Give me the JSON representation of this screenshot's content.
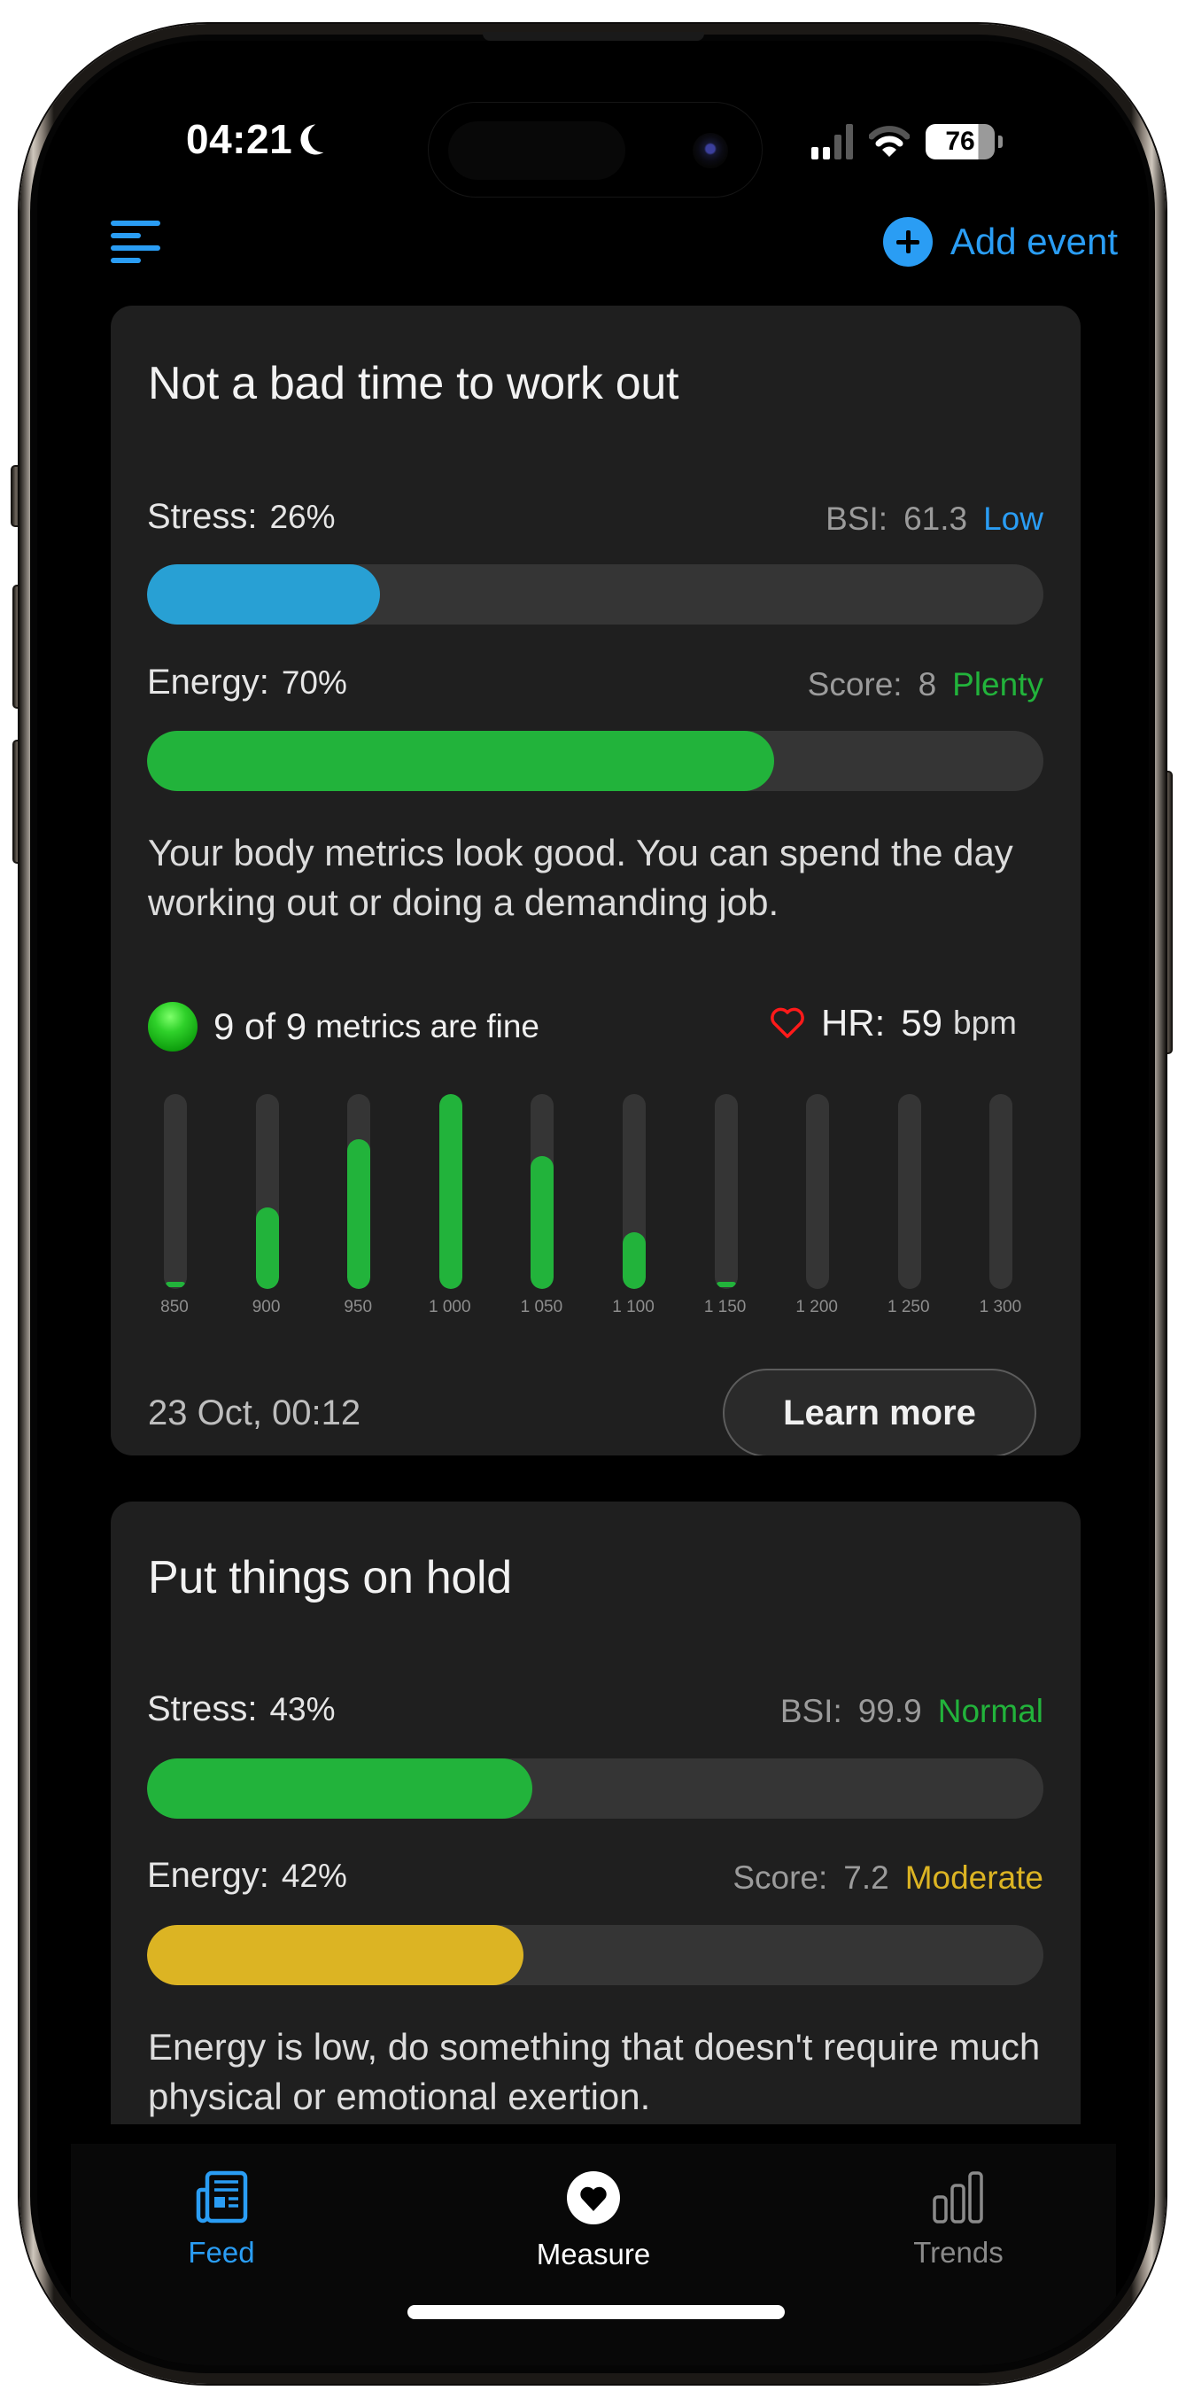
{
  "status_bar": {
    "time": "04:21",
    "focus_icon": "moon-icon",
    "signal_bars_active": 2,
    "signal_bars_total": 4,
    "wifi_icon": "wifi-icon",
    "battery_percent": "76"
  },
  "header": {
    "menu_icon": "menu-icon",
    "add_event_label": "Add event",
    "add_event_icon": "plus-circle-icon"
  },
  "colors": {
    "accent": "#2a9df4",
    "green": "#22b33b",
    "blue_fill": "#28a0d4",
    "yellow": "#dcb423",
    "track": "#353535",
    "card_bg": "#1f1f1f",
    "status_low": "#2a9df4",
    "status_plenty": "#22b33b",
    "status_normal": "#22b33b",
    "status_moderate": "#dcb423",
    "heart": "#ff1a1a"
  },
  "cards": [
    {
      "title": "Not a bad time to work out",
      "stress": {
        "label": "Stress:",
        "value": "26%",
        "fraction": 0.26,
        "metric_label": "BSI:",
        "metric_value": "61.3",
        "status": "Low",
        "fill_color": "#28a0d4",
        "status_color": "#2a9df4"
      },
      "energy": {
        "label": "Energy:",
        "value": "70%",
        "fraction": 0.7,
        "metric_label": "Score:",
        "metric_value": "8",
        "status": "Plenty",
        "fill_color": "#22b33b",
        "status_color": "#22b33b"
      },
      "description": "Your body metrics look good. You can spend the day working out or doing a demanding job.",
      "metrics_summary": {
        "count_text": "9 of 9",
        "suffix": "metrics are fine",
        "status_icon": "green-dot-icon"
      },
      "heart_rate": {
        "label": "HR:",
        "value": "59",
        "unit": "bpm",
        "icon": "heart-outline-icon"
      },
      "date": "23 Oct, 00:12",
      "learn_more_label": "Learn more"
    },
    {
      "title": "Put things on hold",
      "stress": {
        "label": "Stress:",
        "value": "43%",
        "fraction": 0.43,
        "metric_label": "BSI:",
        "metric_value": "99.9",
        "status": "Normal",
        "fill_color": "#22b33b",
        "status_color": "#22b33b"
      },
      "energy": {
        "label": "Energy:",
        "value": "42%",
        "fraction": 0.42,
        "metric_label": "Score:",
        "metric_value": "7.2",
        "status": "Moderate",
        "fill_color": "#dcb423",
        "status_color": "#dcb423"
      },
      "description": "Energy is low, do something that doesn't require much physical or emotional exertion."
    }
  ],
  "chart_data": {
    "type": "bar",
    "title": "",
    "xlabel": "",
    "ylabel": "",
    "categories": [
      "850",
      "900",
      "950",
      "1 000",
      "1 050",
      "1 100",
      "1 150",
      "1 200",
      "1 250",
      "1 300"
    ],
    "values": [
      0.02,
      0.42,
      0.77,
      1.0,
      0.68,
      0.29,
      0.02,
      0,
      0,
      0
    ],
    "ylim": [
      0,
      1
    ],
    "grid": false,
    "legend": "none"
  },
  "tab_bar": {
    "tabs": [
      {
        "label": "Feed",
        "icon": "newspaper-icon",
        "active": true
      },
      {
        "label": "Measure",
        "icon": "heart-circle-icon",
        "active": false
      },
      {
        "label": "Trends",
        "icon": "bar-chart-icon",
        "active": false
      }
    ]
  }
}
